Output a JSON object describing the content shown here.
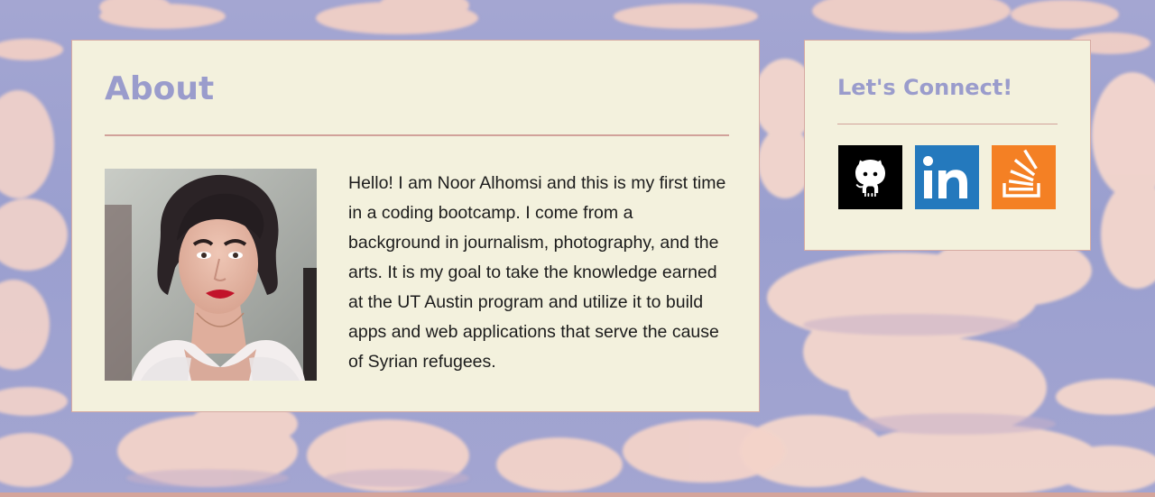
{
  "about": {
    "title": "About",
    "photo_alt": "Portrait of Noor Alhomsi",
    "bio": "Hello! I am Noor Alhomsi and this is my first time in a coding bootcamp. I come from a background in journalism, photography, and the arts. It is my goal to take the knowledge earned at the UT Austin program and utilize it to build apps and web applications that serve the cause of Syrian refugees."
  },
  "connect": {
    "title": "Let's Connect!",
    "links": [
      {
        "label": "GitHub",
        "icon": "github-icon",
        "color": "#000000"
      },
      {
        "label": "LinkedIn",
        "icon": "linkedin-icon",
        "color": "#2479bd"
      },
      {
        "label": "Stack Overflow",
        "icon": "stackoverflow-icon",
        "color": "#f48024"
      }
    ]
  },
  "colors": {
    "card_background": "#f3f1dd",
    "heading": "#9a9ccc",
    "divider": "#d1a29a",
    "sky": "#9ea3cf",
    "cloud": "#f3d2c8"
  }
}
